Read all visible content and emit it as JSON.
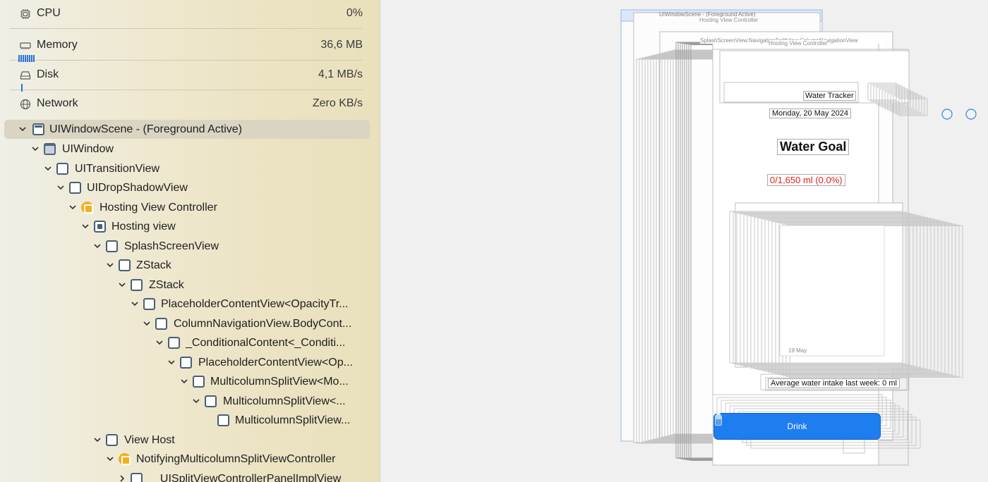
{
  "gauges": [
    {
      "icon": "cpu-icon",
      "label": "CPU",
      "value": "0%"
    },
    {
      "icon": "memory-icon",
      "label": "Memory",
      "value": "36,6 MB"
    },
    {
      "icon": "disk-icon",
      "label": "Disk",
      "value": "4,1 MB/s"
    },
    {
      "icon": "network-icon",
      "label": "Network",
      "value": "Zero KB/s"
    }
  ],
  "tree": [
    {
      "label": "UIWindowScene - (Foreground Active)",
      "icon": "window-scene-icon",
      "selected": true
    },
    {
      "label": "UIWindow",
      "icon": "window-icon"
    },
    {
      "label": "UITransitionView",
      "icon": "view-icon"
    },
    {
      "label": "UIDropShadowView",
      "icon": "view-icon"
    },
    {
      "label": "Hosting View Controller",
      "icon": "view-controller-icon"
    },
    {
      "label": "Hosting view",
      "icon": "hosting-view-icon"
    },
    {
      "label": "SplashScreenView",
      "icon": "view-icon"
    },
    {
      "label": "ZStack",
      "icon": "view-icon"
    },
    {
      "label": "ZStack",
      "icon": "view-icon"
    },
    {
      "label": "PlaceholderContentView<OpacityTr...",
      "icon": "view-icon"
    },
    {
      "label": "ColumnNavigationView.BodyCont...",
      "icon": "view-icon"
    },
    {
      "label": "_ConditionalContent<_Conditi...",
      "icon": "view-icon"
    },
    {
      "label": "PlaceholderContentView<Op...",
      "icon": "view-icon"
    },
    {
      "label": "MulticolumnSplitView<Mo...",
      "icon": "view-icon"
    },
    {
      "label": "MulticolumnSplitView<...",
      "icon": "view-icon"
    },
    {
      "label": "MulticolumnSplitView...",
      "icon": "view-icon"
    },
    {
      "label": "View Host",
      "icon": "view-icon"
    },
    {
      "label": "NotifyingMulticolumnSplitViewController",
      "icon": "view-controller-icon"
    },
    {
      "label": "_UISplitViewControllerPanelImplView",
      "icon": "view-icon"
    }
  ],
  "canvas": {
    "header_label": "UIWindowScene - (Foreground Active)",
    "hosting_label": "Hosting View Controller",
    "hosting_label_2": "Hosting View Controller",
    "split_label": "SplashScreenView.NavigationSplitView.ColumnNavigationView",
    "app_title": "Water Tracker",
    "date": "Monday, 20 May 2024",
    "goal_title": "Water Goal",
    "progress": "0/1,650 ml (0.0%)",
    "chart_axis_label": "19 May",
    "average": "Average water intake last week: 0 ml",
    "drink_button": "Drink",
    "accent": "#1e7ef0",
    "progress_color": "#e0201a"
  }
}
